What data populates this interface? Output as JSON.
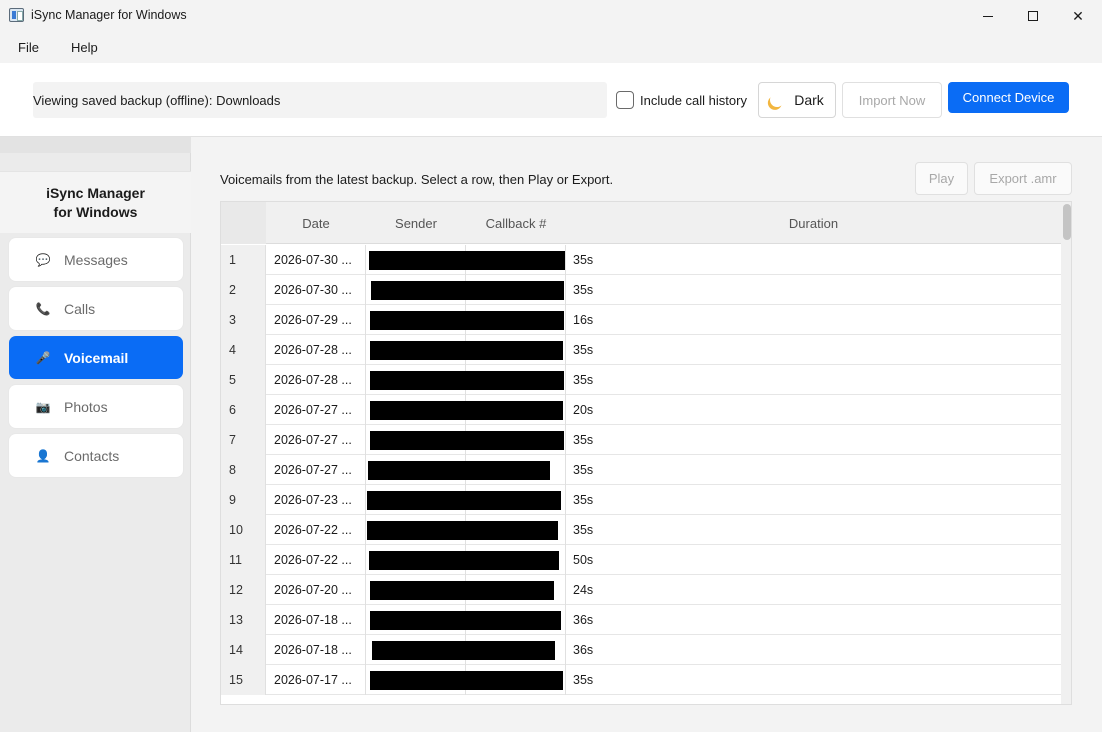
{
  "window": {
    "title": "iSync Manager for Windows",
    "minimize_glyph": "",
    "close_glyph": "✕"
  },
  "menu": {
    "file": "File",
    "help": "Help"
  },
  "toolbar": {
    "status": "Viewing saved backup (offline): Downloads",
    "include_call_history": "Include call history",
    "include_call_history_checked": false,
    "dark_label": "Dark",
    "dark_icon": "moon-icon",
    "import_label": "Import Now",
    "connect_label": "Connect Device",
    "accent_color": "#0a6cf5"
  },
  "sidebar": {
    "brand": "iSync Manager\nfor Windows",
    "items": [
      {
        "label": "Messages",
        "icon": "speech-bubble-icon",
        "glyph": "💬",
        "active": false
      },
      {
        "label": "Calls",
        "icon": "phone-icon",
        "glyph": "📞",
        "active": false
      },
      {
        "label": "Voicemail",
        "icon": "microphone-icon",
        "glyph": "🎤",
        "active": true
      },
      {
        "label": "Photos",
        "icon": "camera-icon",
        "glyph": "📷",
        "active": false
      },
      {
        "label": "Contacts",
        "icon": "person-icon",
        "glyph": "👤",
        "active": false
      }
    ]
  },
  "main": {
    "hint": "Voicemails from the latest backup. Select a row, then Play or Export.",
    "play_label": "Play",
    "export_label": "Export .amr",
    "columns": [
      "Date",
      "Sender",
      "Callback #",
      "Duration"
    ],
    "rows": [
      {
        "n": "1",
        "date": "2026-07-30 ...",
        "duration": "35s"
      },
      {
        "n": "2",
        "date": "2026-07-30 ...",
        "duration": "35s"
      },
      {
        "n": "3",
        "date": "2026-07-29 ...",
        "duration": "16s"
      },
      {
        "n": "4",
        "date": "2026-07-28 ...",
        "duration": "35s"
      },
      {
        "n": "5",
        "date": "2026-07-28 ...",
        "duration": "35s"
      },
      {
        "n": "6",
        "date": "2026-07-27 ...",
        "duration": "20s"
      },
      {
        "n": "7",
        "date": "2026-07-27 ...",
        "duration": "35s"
      },
      {
        "n": "8",
        "date": "2026-07-27 ...",
        "duration": "35s"
      },
      {
        "n": "9",
        "date": "2026-07-23 ...",
        "duration": "35s"
      },
      {
        "n": "10",
        "date": "2026-07-22 ...",
        "duration": "35s"
      },
      {
        "n": "11",
        "date": "2026-07-22 ...",
        "duration": "50s"
      },
      {
        "n": "12",
        "date": "2026-07-20 ...",
        "duration": "24s"
      },
      {
        "n": "13",
        "date": "2026-07-18 ...",
        "duration": "36s"
      },
      {
        "n": "14",
        "date": "2026-07-18 ...",
        "duration": "36s"
      },
      {
        "n": "15",
        "date": "2026-07-17 ...",
        "duration": "35s"
      }
    ]
  }
}
